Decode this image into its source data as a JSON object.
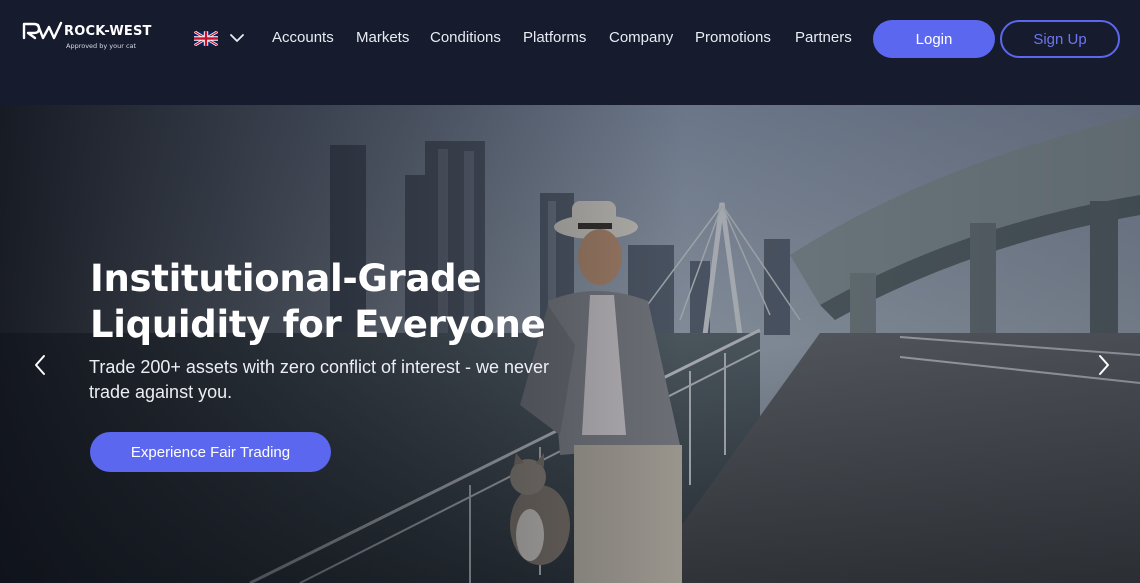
{
  "brand": {
    "name": "ROCK-WEST",
    "tagline": "Approved by your cat"
  },
  "language": {
    "flag_icon": "uk-flag-icon",
    "dropdown_icon": "chevron-down-icon"
  },
  "nav": {
    "items": [
      "Accounts",
      "Markets",
      "Conditions",
      "Platforms",
      "Company",
      "Promotions",
      "Partners"
    ]
  },
  "auth": {
    "login_label": "Login",
    "signup_label": "Sign Up"
  },
  "hero": {
    "title_line1": "Institutional-Grade",
    "title_line2": "Liquidity for Everyone",
    "subtitle": "Trade 200+ assets with zero conflict of interest - we never trade against you.",
    "cta_label": "Experience Fair Trading",
    "prev_icon": "chevron-left-icon",
    "next_icon": "chevron-right-icon"
  },
  "colors": {
    "header_bg": "#161b2e",
    "accent": "#5b67ee",
    "text": "#ffffff"
  }
}
